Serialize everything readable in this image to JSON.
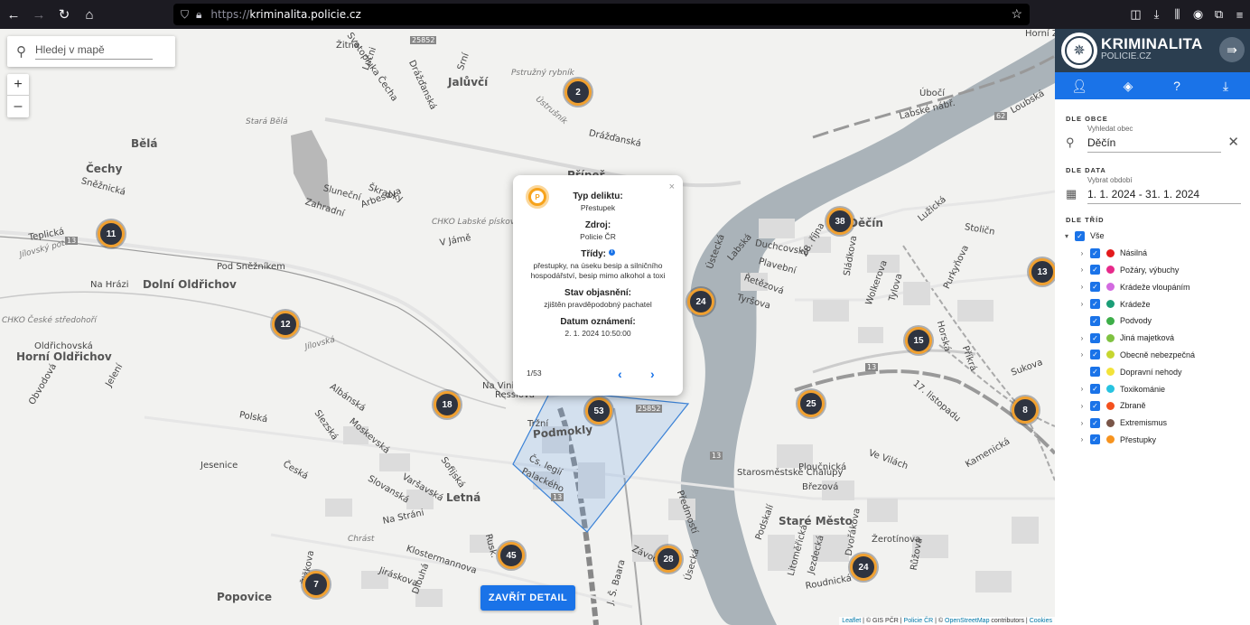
{
  "browser": {
    "url_prefix": "https://",
    "url_host": "kriminalita.policie.cz",
    "back_icon": "arrow-left-icon",
    "forward_icon": "arrow-right-icon",
    "reload_icon": "reload-icon",
    "home_icon": "home-icon"
  },
  "map": {
    "search_placeholder": "Hledej v mapě",
    "zoom_in": "+",
    "zoom_out": "–",
    "labels": [
      "Horní Žl",
      "Žitná",
      "Svatopluka Čecha",
      "Lučni",
      "Drážďanská",
      "Jalůvčí",
      "Srní",
      "Pstružný rybník",
      "Ústrušník",
      "Úbočí",
      "Labské nábř.",
      "Loubská",
      "Stará Bělá",
      "Bělá",
      "Čechy",
      "Sněžnická",
      "Drážďanská",
      "Přípeř",
      "Sluneční",
      "Škrabky",
      "Zahradní",
      "Arbesova",
      "CHKO Labské pískovce",
      "V Jámě",
      "Teplická",
      "Jílovský potok",
      "Pod Sněžníkem",
      "Dolní Oldřichov",
      "Na Hrázi",
      "CHKO České středohoří",
      "Oldřichovská",
      "Horní Oldřichov",
      "Jílovská",
      "Na Vinici",
      "Ressiova",
      "Podmokly",
      "Tržní",
      "Čs. legií",
      "Palackého",
      "Letná",
      "Rusk.",
      "Polská",
      "Slezská",
      "Jelení",
      "Obvodová",
      "Albánská",
      "Moskevská",
      "Jesenice",
      "Česká",
      "Varšavská",
      "Slovanská",
      "Sofijská",
      "Na Stráni",
      "Chrást",
      "Klostermannova",
      "Jiráskova",
      "Popovice",
      "Dlouhá",
      "Žižkova",
      "Závodní",
      "Úsecká",
      "Předmostí",
      "J. Š. Baara",
      "Starosměstské Chalupy",
      "Staré Město",
      "Ploučnická",
      "Březová",
      "Děčín",
      "Tyršova",
      "Řetězová",
      "Plavební",
      "Duchcovská",
      "28. října",
      "Sládkova",
      "Wolkerova",
      "Tylova",
      "Purkyňova",
      "Horská",
      "Příkrá",
      "Sukova",
      "Stoličn",
      "Lužická",
      "17. listopadu",
      "Ve Vilách",
      "Ústecká",
      "Podskalí",
      "Labská",
      "Dvořákova",
      "Žerotínova",
      "Růžová",
      "Roudnická",
      "Litoměřická",
      "Jezdecká",
      "Kamenická"
    ],
    "clusters": [
      "2",
      "11",
      "12",
      "18",
      "53",
      "45",
      "7",
      "28",
      "24",
      "38",
      "25",
      "15",
      "13",
      "8",
      "24"
    ],
    "road_badges": [
      "25852",
      "13",
      "62",
      "13",
      "13",
      "13",
      "25852",
      "13",
      "13"
    ]
  },
  "popup": {
    "icon_letter": "P",
    "close": "×",
    "type_label": "Typ deliktu:",
    "type_value": "Přestupek",
    "source_label": "Zdroj:",
    "source_value": "Policie ČR",
    "classes_label": "Třídy:",
    "info_icon": "i",
    "classes_value": "přestupky, na úseku besip a silničního hospodářství, besip mimo alkohol a toxi",
    "status_label": "Stav objasnění:",
    "status_value": "zjištěn pravděpodobný pachatel",
    "date_label": "Datum oznámení:",
    "date_value": "2. 1. 2024 10:50:00",
    "pager": "1/53",
    "prev": "‹",
    "next": "›"
  },
  "close_detail": "ZAVŘÍT DETAIL",
  "attribution": {
    "leaflet": "Leaflet",
    "gis": " | © GIS PČR | ",
    "policie": "Policie ČR",
    "sep": " | © ",
    "osm": "OpenStreetMap",
    "contributors": " contributors | ",
    "cookies": "Cookies"
  },
  "panel": {
    "brand_title": "KRIMINALITA",
    "brand_sub": "POLICIE.CZ",
    "collapse_icon": "⇛",
    "tabs": [
      "user-icon",
      "layers-icon",
      "help-icon",
      "download-icon"
    ],
    "obec_section": "DLE OBCE",
    "obec_label": "Vyhledat obec",
    "obec_value": "Děčín",
    "date_section": "DLE DATA",
    "date_label": "Vybrat období",
    "date_value": "1. 1. 2024 - 31. 1. 2024",
    "class_section": "DLE TŘÍD",
    "all_label": "Vše",
    "classes": [
      {
        "name": "Násilná",
        "color": "#e31a1c",
        "expandable": true
      },
      {
        "name": "Požáry, výbuchy",
        "color": "#e7298a",
        "expandable": true
      },
      {
        "name": "Krádeže vloupáním",
        "color": "#d36ae0",
        "expandable": true
      },
      {
        "name": "Krádeže",
        "color": "#1b9e77",
        "expandable": true
      },
      {
        "name": "Podvody",
        "color": "#3dae49",
        "expandable": false
      },
      {
        "name": "Jiná majetková",
        "color": "#7fc241",
        "expandable": true
      },
      {
        "name": "Obecně nebezpečná",
        "color": "#c6d630",
        "expandable": true
      },
      {
        "name": "Dopravní nehody",
        "color": "#f3e33a",
        "expandable": false
      },
      {
        "name": "Toxikománie",
        "color": "#27c3e0",
        "expandable": true
      },
      {
        "name": "Zbraně",
        "color": "#f4511e",
        "expandable": true
      },
      {
        "name": "Extremismus",
        "color": "#795548",
        "expandable": true
      },
      {
        "name": "Přestupky",
        "color": "#f7931e",
        "expandable": true
      }
    ]
  }
}
